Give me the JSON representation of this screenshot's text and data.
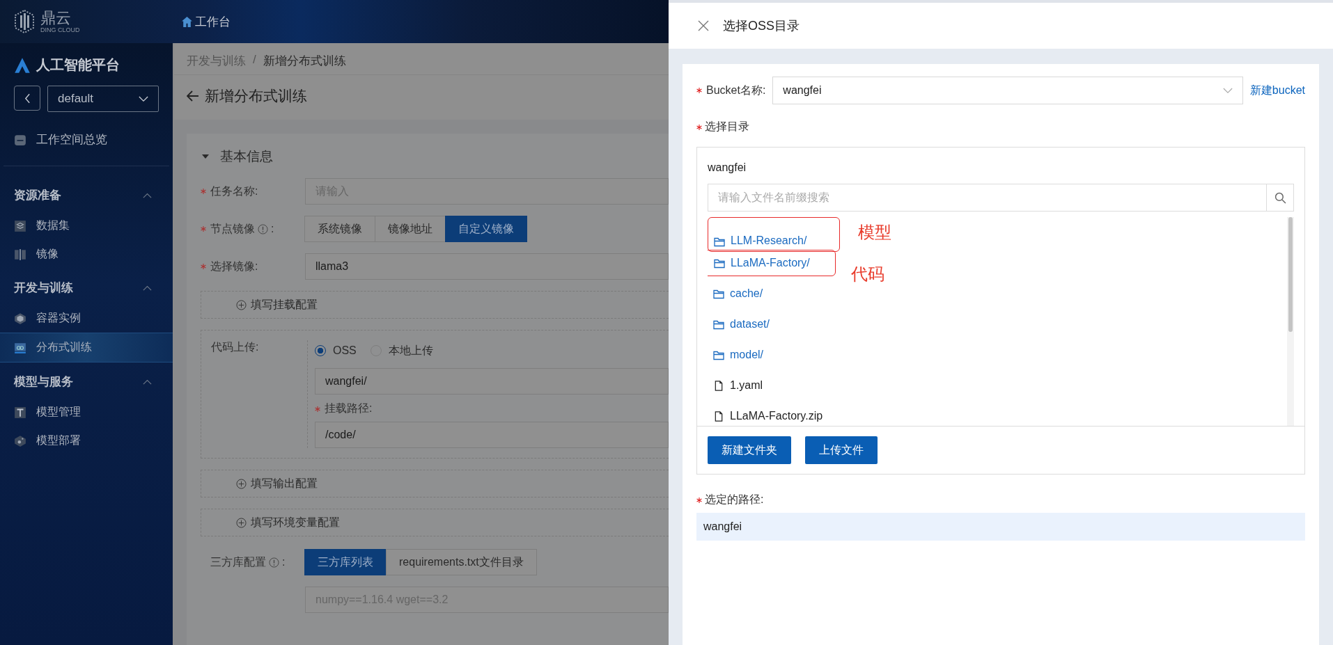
{
  "header": {
    "logo_text": "鼎云",
    "logo_sub": "DING CLOUD",
    "nav": "工作台"
  },
  "sidebar": {
    "platform": "人工智能平台",
    "workspace": "default",
    "overview": "工作空间总览",
    "groups": [
      {
        "title": "资源准备",
        "expanded": true,
        "items": [
          {
            "label": "数据集",
            "selected": false
          },
          {
            "label": "镜像",
            "selected": false
          }
        ]
      },
      {
        "title": "开发与训练",
        "expanded": true,
        "items": [
          {
            "label": "容器实例",
            "selected": false
          },
          {
            "label": "分布式训练",
            "selected": true
          }
        ]
      },
      {
        "title": "模型与服务",
        "expanded": true,
        "items": [
          {
            "label": "模型管理",
            "selected": false
          },
          {
            "label": "模型部署",
            "selected": false
          }
        ]
      }
    ]
  },
  "main": {
    "breadcrumb": [
      "开发与训练",
      "新增分布式训练"
    ],
    "breadcrumb_separator": "/",
    "title": "新增分布式训练",
    "section": {
      "title": "基本信息",
      "expanded": true
    },
    "task_name": {
      "label": "任务名称:",
      "required": true,
      "placeholder": "请输入"
    },
    "node_image": {
      "label": "节点镜像",
      "colon": ":",
      "required": true,
      "options": [
        {
          "label": "系统镜像",
          "selected": false
        },
        {
          "label": "镜像地址",
          "selected": false
        },
        {
          "label": "自定义镜像",
          "selected": true
        }
      ]
    },
    "select_image": {
      "label": "选择镜像:",
      "required": true,
      "value": "llama3"
    },
    "mount_config": "填写挂载配置",
    "code_upload": {
      "label": "代码上传:",
      "options": [
        {
          "label": "OSS",
          "selected": true
        },
        {
          "label": "本地上传",
          "selected": false
        }
      ],
      "path_value": "wangfei/",
      "mount_label": "挂载路径:",
      "mount_required": true,
      "mount_value": "/code/"
    },
    "output_config": "填写输出配置",
    "env_config": "填写环境变量配置",
    "third_party": {
      "label": "三方库配置",
      "colon": ":",
      "options": [
        {
          "label": "三方库列表",
          "selected": true
        },
        {
          "label": "requirements.txt文件目录",
          "selected": false
        }
      ],
      "placeholder": "numpy==1.16.4 wget==3.2"
    }
  },
  "drawer": {
    "title": "选择OSS目录",
    "bucket": {
      "label": "Bucket名称:",
      "required": true,
      "value": "wangfei",
      "link": "新建bucket"
    },
    "dir_label": "选择目录",
    "dir_required": true,
    "browser": {
      "root": "wangfei",
      "search_placeholder": "请输入文件名前缀搜索",
      "items": [
        {
          "name": "LLM-Research/",
          "kind": "folder",
          "annotation": "模型"
        },
        {
          "name": "LLaMA-Factory/",
          "kind": "folder",
          "annotation": "代码"
        },
        {
          "name": "cache/",
          "kind": "folder"
        },
        {
          "name": "dataset/",
          "kind": "folder"
        },
        {
          "name": "model/",
          "kind": "folder"
        },
        {
          "name": "1.yaml",
          "kind": "file"
        },
        {
          "name": "LLaMA-Factory.zip",
          "kind": "file"
        }
      ],
      "buttons": [
        "新建文件夹",
        "上传文件"
      ]
    },
    "selected_path": {
      "label": "选定的路径:",
      "required": true,
      "value": "wangfei"
    }
  }
}
